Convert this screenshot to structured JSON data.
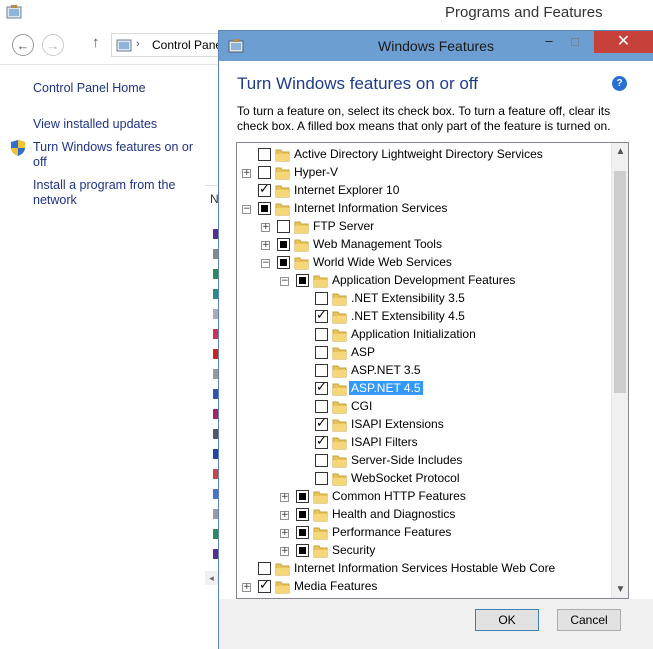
{
  "background_window": {
    "title": "Programs and Features",
    "address": "Control Panel",
    "left_pane": {
      "home": "Control Panel Home",
      "view_updates": "View installed updates",
      "turn_features": "Turn Windows features on or off",
      "install_program": "Install a program from the network"
    },
    "list_header_fragment": "N"
  },
  "dialog": {
    "title": "Windows Features",
    "heading": "Turn Windows features on or off",
    "description": "To turn a feature on, select its check box. To turn a feature off, clear its check box. A filled box means that only part of the feature is turned on.",
    "ok_label": "OK",
    "cancel_label": "Cancel",
    "help_glyph": "?",
    "selected_item": "ASP.NET 4.5"
  },
  "features": [
    {
      "label": "Active Directory Lightweight Directory Services",
      "level": 0,
      "expander": "none",
      "state": "unchecked"
    },
    {
      "label": "Hyper-V",
      "level": 0,
      "expander": "plus",
      "state": "unchecked"
    },
    {
      "label": "Internet Explorer 10",
      "level": 0,
      "expander": "none",
      "state": "checked"
    },
    {
      "label": "Internet Information Services",
      "level": 0,
      "expander": "minus",
      "state": "partial"
    },
    {
      "label": "FTP Server",
      "level": 1,
      "expander": "plus",
      "state": "unchecked"
    },
    {
      "label": "Web Management Tools",
      "level": 1,
      "expander": "plus",
      "state": "partial"
    },
    {
      "label": "World Wide Web Services",
      "level": 1,
      "expander": "minus",
      "state": "partial"
    },
    {
      "label": "Application Development Features",
      "level": 2,
      "expander": "minus",
      "state": "partial"
    },
    {
      "label": ".NET Extensibility 3.5",
      "level": 3,
      "expander": "none",
      "state": "unchecked"
    },
    {
      "label": ".NET Extensibility 4.5",
      "level": 3,
      "expander": "none",
      "state": "checked"
    },
    {
      "label": "Application Initialization",
      "level": 3,
      "expander": "none",
      "state": "unchecked"
    },
    {
      "label": "ASP",
      "level": 3,
      "expander": "none",
      "state": "unchecked"
    },
    {
      "label": "ASP.NET 3.5",
      "level": 3,
      "expander": "none",
      "state": "unchecked"
    },
    {
      "label": "ASP.NET 4.5",
      "level": 3,
      "expander": "none",
      "state": "checked",
      "selected": true
    },
    {
      "label": "CGI",
      "level": 3,
      "expander": "none",
      "state": "unchecked"
    },
    {
      "label": "ISAPI Extensions",
      "level": 3,
      "expander": "none",
      "state": "checked"
    },
    {
      "label": "ISAPI Filters",
      "level": 3,
      "expander": "none",
      "state": "checked"
    },
    {
      "label": "Server-Side Includes",
      "level": 3,
      "expander": "none",
      "state": "unchecked"
    },
    {
      "label": "WebSocket Protocol",
      "level": 3,
      "expander": "none",
      "state": "unchecked"
    },
    {
      "label": "Common HTTP Features",
      "level": 2,
      "expander": "plus",
      "state": "partial"
    },
    {
      "label": "Health and Diagnostics",
      "level": 2,
      "expander": "plus",
      "state": "partial"
    },
    {
      "label": "Performance Features",
      "level": 2,
      "expander": "plus",
      "state": "partial"
    },
    {
      "label": "Security",
      "level": 2,
      "expander": "plus",
      "state": "partial"
    },
    {
      "label": "Internet Information Services Hostable Web Core",
      "level": 0,
      "expander": "none",
      "state": "unchecked"
    },
    {
      "label": "Media Features",
      "level": 0,
      "expander": "plus",
      "state": "checked"
    }
  ],
  "colors": {
    "dialog_titlebar": "#6d9ed1",
    "close_button": "#c7413b",
    "heading": "#1e3c8c",
    "link": "#1e3287",
    "selection": "#3399ff",
    "folder": "#e8c45a"
  }
}
